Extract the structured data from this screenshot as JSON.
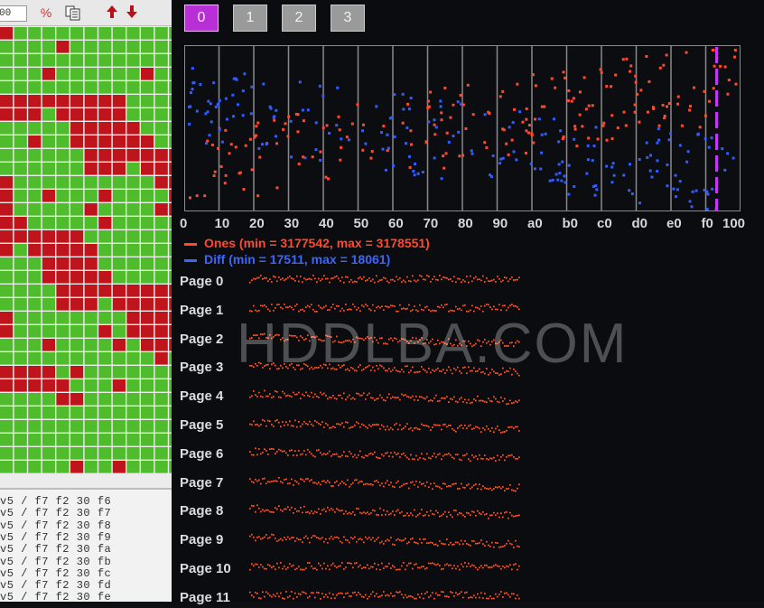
{
  "left_panel": {
    "toolbar": {
      "input_value": "00",
      "percent_icon": "percent-icon",
      "copy_icon": "copy-icon",
      "up_icon": "arrow-up-icon",
      "down_icon": "arrow-down-icon"
    },
    "hex_lines": [
      "v5 / f7 f2 30 f6",
      "v5 / f7 f2 30 f7",
      "v5 / f7 f2 30 f8",
      "v5 / f7 f2 30 f9",
      "v5 / f7 f2 30 fa",
      "v5 / f7 f2 30 fb",
      "v5 / f7 f2 30 fc",
      "v5 / f7 f2 30 fd",
      "v5 / f7 f2 30 fe"
    ]
  },
  "tabs": [
    "0",
    "1",
    "2",
    "3"
  ],
  "active_tab": "0",
  "chart_data": {
    "type": "scatter",
    "x_ticks": [
      "0",
      "10",
      "20",
      "30",
      "40",
      "50",
      "60",
      "70",
      "80",
      "90",
      "a0",
      "b0",
      "c0",
      "d0",
      "e0",
      "f0",
      "100"
    ],
    "series": [
      {
        "name": "Ones (min = 3177542, max = 3178551)",
        "color": "#ff4a2e"
      },
      {
        "name": "Diff (min = 17511, max = 18061)",
        "color": "#2f5dff"
      }
    ],
    "marker_color": "#cc33ff"
  },
  "pages": [
    "Page 0",
    "Page 1",
    "Page 2",
    "Page 3",
    "Page 4",
    "Page 5",
    "Page 6",
    "Page 7",
    "Page 8",
    "Page 9",
    "Page 10",
    "Page 11"
  ],
  "watermark": "HDDLBA.COM",
  "colors": {
    "grid_green": "#4fbd2b",
    "grid_red": "#c0141c",
    "strip_dot": "#ff5a30"
  }
}
